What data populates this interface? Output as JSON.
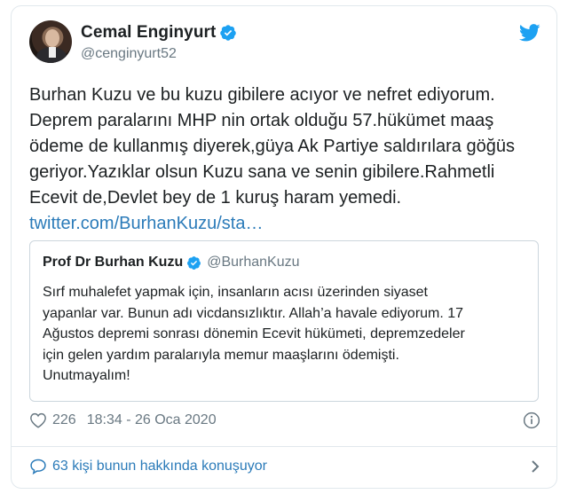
{
  "author": {
    "display_name": "Cemal Enginyurt",
    "handle": "@cenginyurt52"
  },
  "tweet": {
    "lines": [
      "Burhan Kuzu ve bu kuzu gibilere acıyor ve nefret ediyorum.",
      "Deprem paralarını MHP nin ortak olduğu 57.hükümet maaş",
      "ödeme de kullanmış diyerek,güya Ak Partiye saldırılara göğüs",
      "geriyor.Yazıklar olsun Kuzu sana ve senin gibilere.Rahmetli",
      "Ecevit de,Devlet bey de 1 kuruş haram yemedi."
    ],
    "link": "twitter.com/BurhanKuzu/sta…"
  },
  "quote": {
    "display_name": "Prof Dr Burhan Kuzu",
    "handle": "@BurhanKuzu",
    "lines": [
      "Sırf muhalefet yapmak için, insanların acısı üzerinden siyaset",
      "yapanlar var. Bunun adı vicdansızlıktır. Allah’a havale ediyorum. 17",
      "Ağustos depremi sonrası dönemin Ecevit hükümeti, depremzedeler",
      "için gelen yardım paralarıyla memur maaşlarını ödemişti.",
      "Unutmayalım!"
    ]
  },
  "meta": {
    "likes": "226",
    "timestamp": "18:34 - 26 Oca 2020"
  },
  "footer": {
    "conversation": "63 kişi bunun hakkında konuşuyor"
  },
  "colors": {
    "link": "#2b7bb9",
    "verified": "#1da1f2",
    "secondary_text": "#697882",
    "border": "#e1e8ed"
  },
  "icons": {
    "verified": "verified-badge-icon",
    "brand": "twitter-bird-icon",
    "like": "heart-icon",
    "info": "info-icon",
    "reply": "speech-bubble-icon",
    "more": "chevron-right-icon"
  }
}
